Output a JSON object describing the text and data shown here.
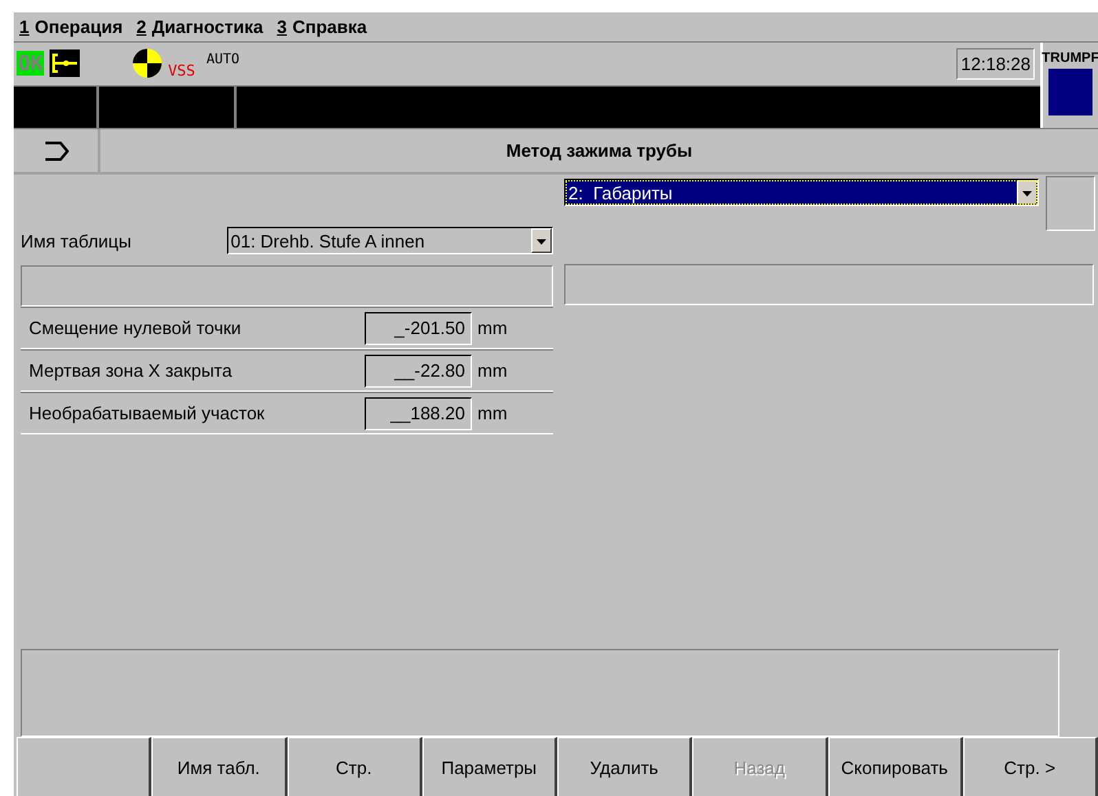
{
  "menu": [
    {
      "number": "1",
      "label": "Операция"
    },
    {
      "number": "2",
      "label": "Диагностика"
    },
    {
      "number": "3",
      "label": "Справка"
    }
  ],
  "status": {
    "ok": "OK",
    "vss": "VSS",
    "mode": "AUTO",
    "time": "12:18:28",
    "brand": "TRUMPF"
  },
  "header": {
    "title": "Метод зажима трубы"
  },
  "view_select": {
    "value": "2:  Габариты"
  },
  "table_name": {
    "label": "Имя таблицы",
    "value": "01: Drehb. Stufe A innen"
  },
  "parameters": [
    {
      "label": "Смещение нулевой точки",
      "value": "_-201.50",
      "unit": "mm"
    },
    {
      "label": "Мертвая зона X закрыта",
      "value": "__-22.80",
      "unit": "mm"
    },
    {
      "label": "Необрабатываемый участок",
      "value": "__188.20",
      "unit": "mm"
    }
  ],
  "softkeys": [
    {
      "kind": "blank"
    },
    {
      "kind": "labeled",
      "label": "Имя табл.",
      "disabled": false
    },
    {
      "kind": "labeled",
      "label": "Стр.",
      "disabled": false
    },
    {
      "kind": "labeled",
      "label": "Параметры",
      "disabled": false
    },
    {
      "kind": "labeled",
      "label": "Удалить",
      "disabled": false
    },
    {
      "kind": "labeled",
      "label": "Назад",
      "disabled": true
    },
    {
      "kind": "labeled",
      "label": "Скопировать",
      "disabled": false
    },
    {
      "kind": "labeled",
      "label": "Стр. >",
      "disabled": false
    }
  ]
}
